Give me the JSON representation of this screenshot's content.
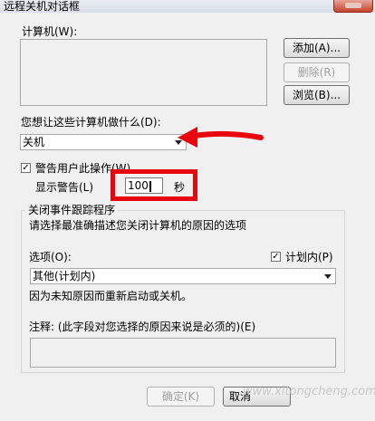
{
  "window": {
    "title": "远程关机对话框"
  },
  "computers": {
    "label": "计算机(W):",
    "add_button": "添加(A)...",
    "remove_button": "删除(R)",
    "browse_button": "浏览(B)..."
  },
  "action": {
    "label": "您想让这些计算机做什么(D):",
    "selected": "关机"
  },
  "warning": {
    "checkbox_label": "警告用户此操作(W)",
    "checked": true,
    "display_label": "显示警告(L)",
    "seconds_value": "100",
    "seconds_unit": "秒"
  },
  "tracker": {
    "group_title": "关闭事件跟踪程序",
    "description": "请选择最准确描述您关闭计算机的原因的选项",
    "option_label": "选项(O):",
    "planned_label": "计划内(P)",
    "planned_checked": true,
    "selected_reason": "其他(计划内)",
    "reason_text": "因为未知原因而重新启动或关机。",
    "comment_label": "注释: (此字段对您选择的原因来说是必须的)(E)"
  },
  "footer": {
    "ok_button": "确定(K)",
    "cancel_button": "取消"
  },
  "watermark": "www.xitongcheng.com",
  "colors": {
    "annotation_red": "#e8060d"
  }
}
